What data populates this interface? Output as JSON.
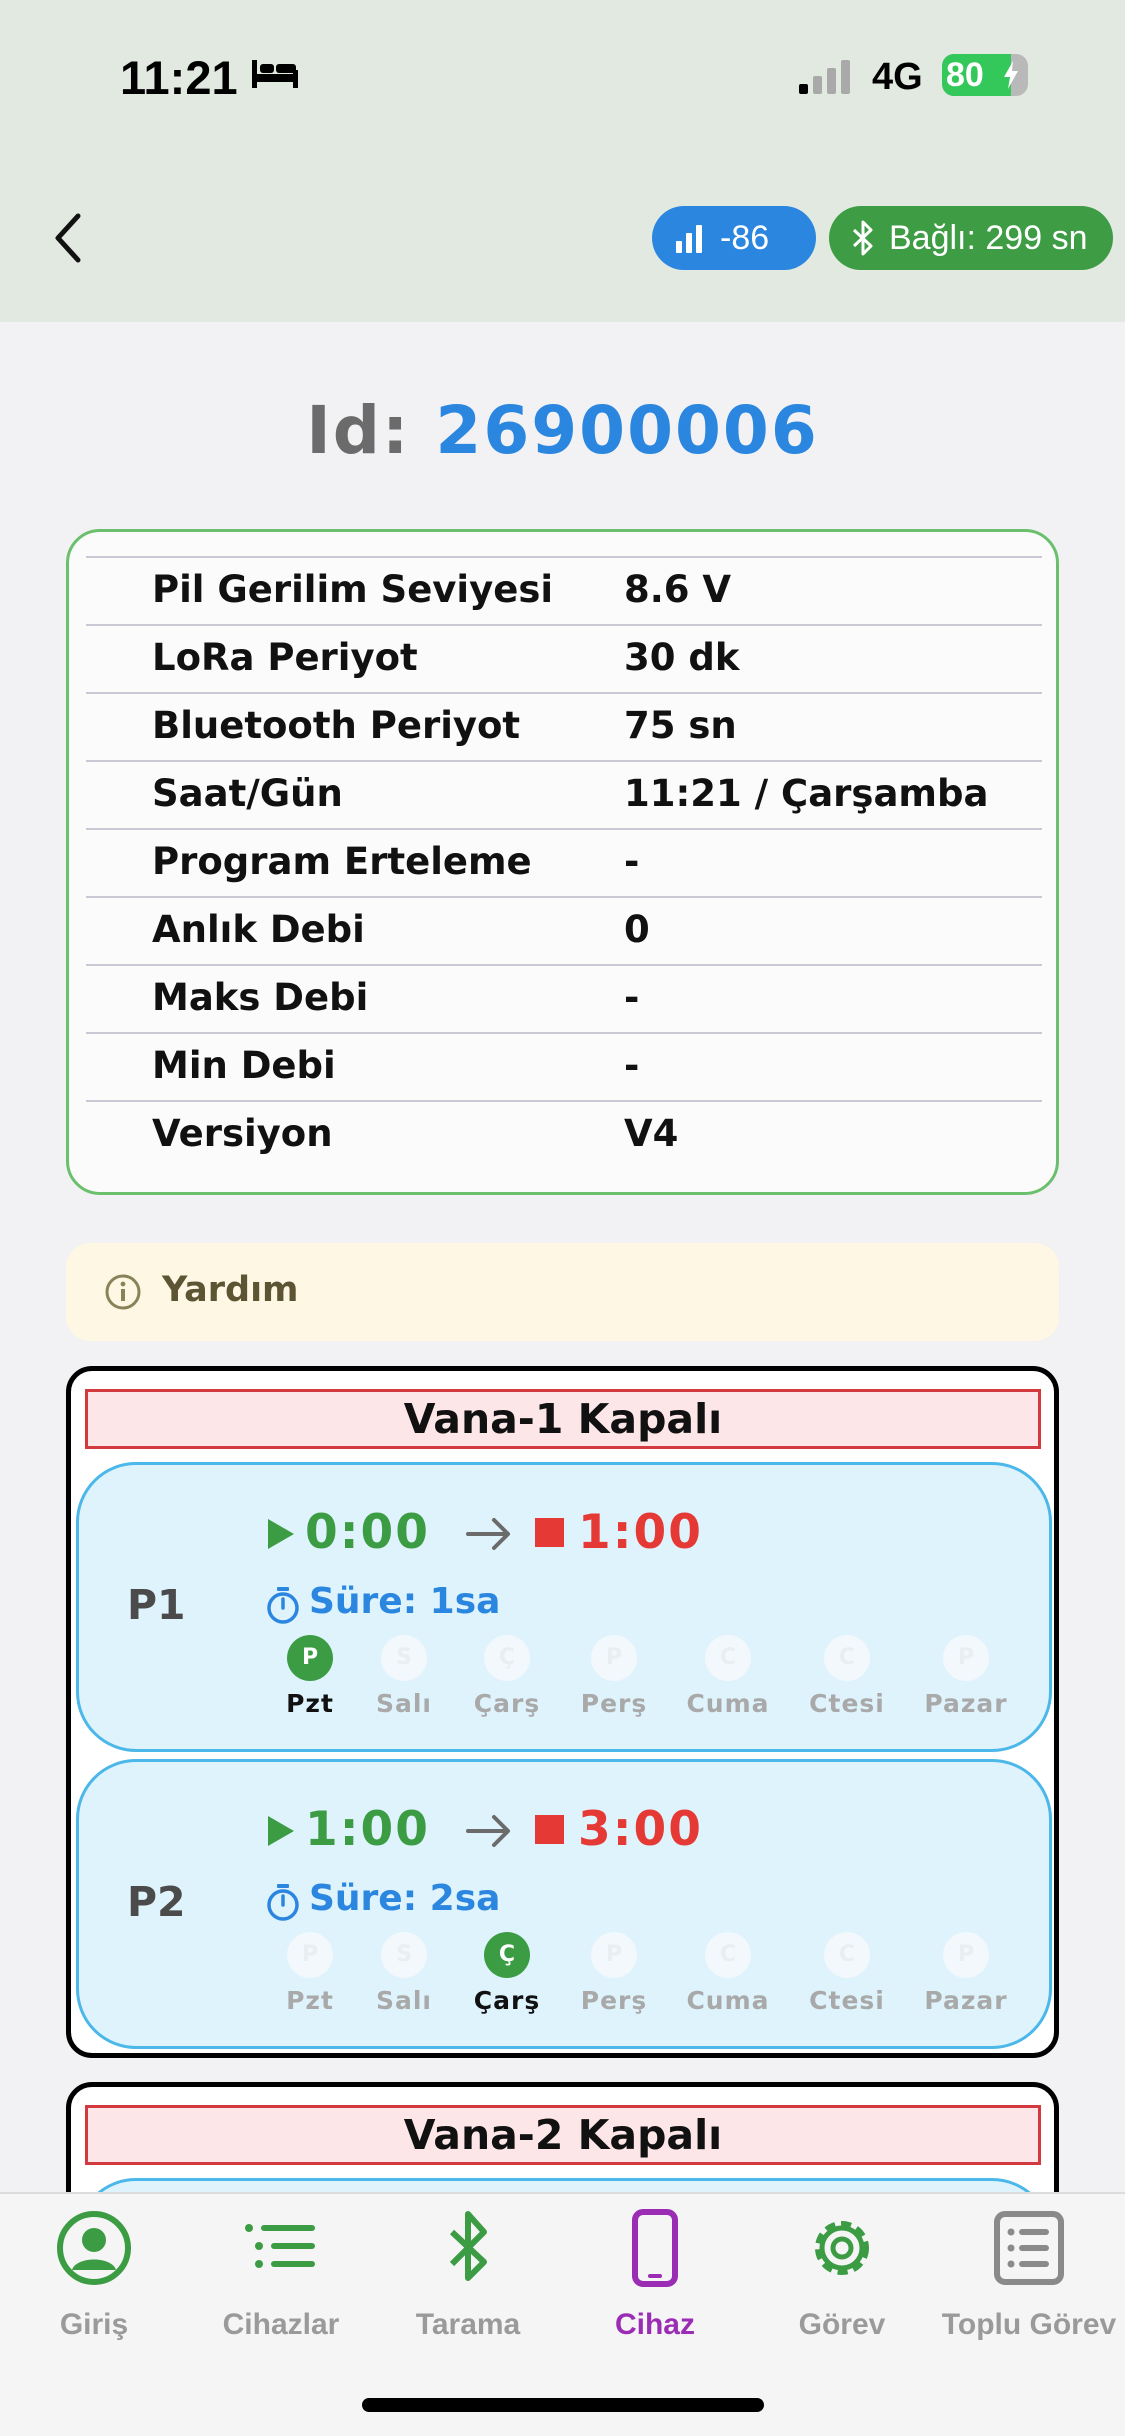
{
  "status_bar": {
    "time": "11:21",
    "network": "4G",
    "battery": "80"
  },
  "header": {
    "rssi": "-86",
    "bluetooth_status": "Bağlı: 299 sn"
  },
  "device": {
    "id_label": "Id:",
    "id_value": "26900006"
  },
  "info_rows": [
    {
      "label": "Pil Gerilim Seviyesi",
      "value": "8.6 V"
    },
    {
      "label": "LoRa Periyot",
      "value": "30 dk"
    },
    {
      "label": "Bluetooth Periyot",
      "value": "75 sn"
    },
    {
      "label": "Saat/Gün",
      "value": "11:21 / Çarşamba"
    },
    {
      "label": "Program Erteleme",
      "value": "-"
    },
    {
      "label": "Anlık Debi",
      "value": "0"
    },
    {
      "label": "Maks Debi",
      "value": "-"
    },
    {
      "label": "Min Debi",
      "value": "-"
    },
    {
      "label": "Versiyon",
      "value": "V4"
    }
  ],
  "help": {
    "label": "Yardım"
  },
  "valves": [
    {
      "title": "Vana-1 Kapalı",
      "programs": [
        {
          "name": "P1",
          "start": "0:00",
          "end": "1:00",
          "duration": "Süre: 1sa",
          "days": [
            {
              "label": "Pzt",
              "letter": "P",
              "active": true
            },
            {
              "label": "Salı",
              "letter": "S",
              "active": false
            },
            {
              "label": "Çarş",
              "letter": "Ç",
              "active": false
            },
            {
              "label": "Perş",
              "letter": "P",
              "active": false
            },
            {
              "label": "Cuma",
              "letter": "C",
              "active": false
            },
            {
              "label": "Ctesi",
              "letter": "C",
              "active": false
            },
            {
              "label": "Pazar",
              "letter": "P",
              "active": false
            }
          ]
        },
        {
          "name": "P2",
          "start": "1:00",
          "end": "3:00",
          "duration": "Süre: 2sa",
          "days": [
            {
              "label": "Pzt",
              "letter": "P",
              "active": false
            },
            {
              "label": "Salı",
              "letter": "S",
              "active": false
            },
            {
              "label": "Çarş",
              "letter": "Ç",
              "active": true
            },
            {
              "label": "Perş",
              "letter": "P",
              "active": false
            },
            {
              "label": "Cuma",
              "letter": "C",
              "active": false
            },
            {
              "label": "Ctesi",
              "letter": "C",
              "active": false
            },
            {
              "label": "Pazar",
              "letter": "P",
              "active": false
            }
          ]
        }
      ]
    },
    {
      "title": "Vana-2 Kapalı",
      "programs": []
    }
  ],
  "tabs": [
    {
      "label": "Giriş",
      "icon": "user-circle-icon",
      "color": "#3c9c43"
    },
    {
      "label": "Cihazlar",
      "icon": "list-icon",
      "color": "#3c9c43"
    },
    {
      "label": "Tarama",
      "icon": "bluetooth-icon",
      "color": "#3c9c43"
    },
    {
      "label": "Cihaz",
      "icon": "phone-icon",
      "color": "#9b2db5",
      "active": true
    },
    {
      "label": "Görev",
      "icon": "gear-icon",
      "color": "#3c9c43"
    },
    {
      "label": "Toplu Görev",
      "icon": "task-list-icon",
      "color": "#8a8a8a"
    }
  ],
  "colors": {
    "accent_green": "#3c9c43",
    "accent_blue": "#2b86e0",
    "stop_red": "#e53935",
    "active_tab": "#9b2db5"
  }
}
